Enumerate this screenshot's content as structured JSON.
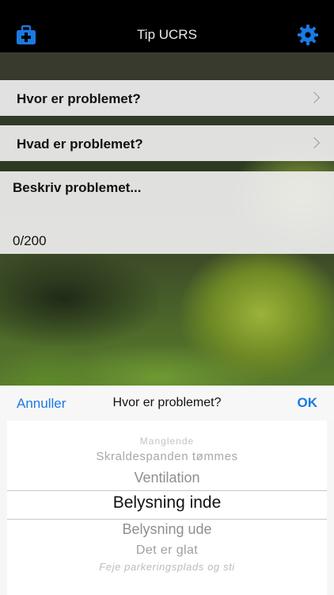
{
  "navbar": {
    "title": "Tip UCRS",
    "left_icon": "first-aid-kit-icon",
    "right_icon": "gear-icon",
    "icon_color": "#1a7ae0"
  },
  "form": {
    "where_label": "Hvor er problemet?",
    "what_label": "Hvad er problemet?",
    "describe_placeholder": "Beskriv problemet...",
    "char_counter": "0/200"
  },
  "picker_sheet": {
    "cancel_label": "Annuller",
    "title": "Hvor er problemet?",
    "ok_label": "OK",
    "options": [
      "Manglende",
      "Skraldespanden tømmes",
      "Ventilation",
      "Belysning inde",
      "Belysning ude",
      "Det er glat",
      "Feje parkeringsplads og sti"
    ],
    "selected": "Belysning inde"
  },
  "colors": {
    "accent": "#1a7ae0"
  }
}
